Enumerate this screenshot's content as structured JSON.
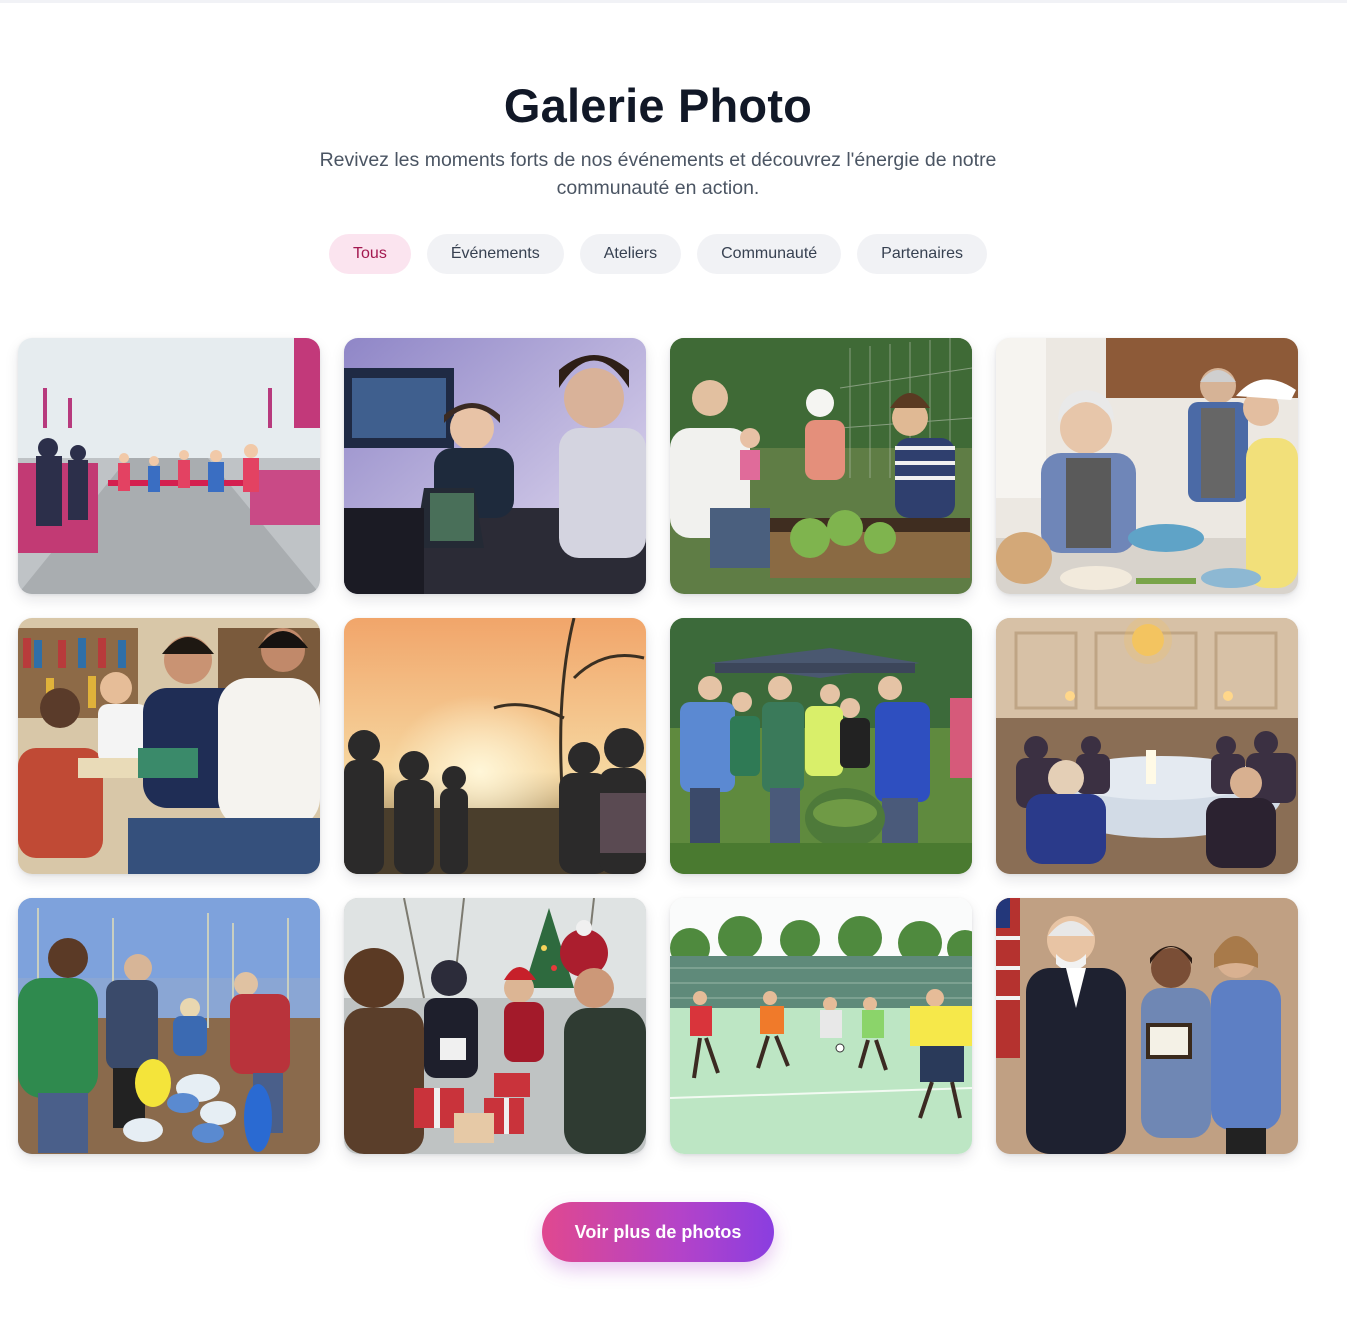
{
  "gallery": {
    "title": "Galerie Photo",
    "subtitle": "Revivez les moments forts de nos événements et découvrez l'énergie de notre communauté en action."
  },
  "filters": [
    {
      "label": "Tous",
      "active": true
    },
    {
      "label": "Événements",
      "active": false
    },
    {
      "label": "Ateliers",
      "active": false
    },
    {
      "label": "Communauté",
      "active": false
    },
    {
      "label": "Partenaires",
      "active": false
    }
  ],
  "photos": [
    {
      "name": "photo-marathon-finish"
    },
    {
      "name": "photo-hackathon-laptops"
    },
    {
      "name": "photo-community-garden"
    },
    {
      "name": "photo-cooking-workshop"
    },
    {
      "name": "photo-reading-session"
    },
    {
      "name": "photo-sunset-gathering"
    },
    {
      "name": "photo-outdoor-volunteers"
    },
    {
      "name": "photo-gala-dinner"
    },
    {
      "name": "photo-tree-planting-cleanup"
    },
    {
      "name": "photo-holiday-gift-drive"
    },
    {
      "name": "photo-futsal-match"
    },
    {
      "name": "photo-award-ceremony"
    }
  ],
  "cta": {
    "label": "Voir plus de photos"
  }
}
